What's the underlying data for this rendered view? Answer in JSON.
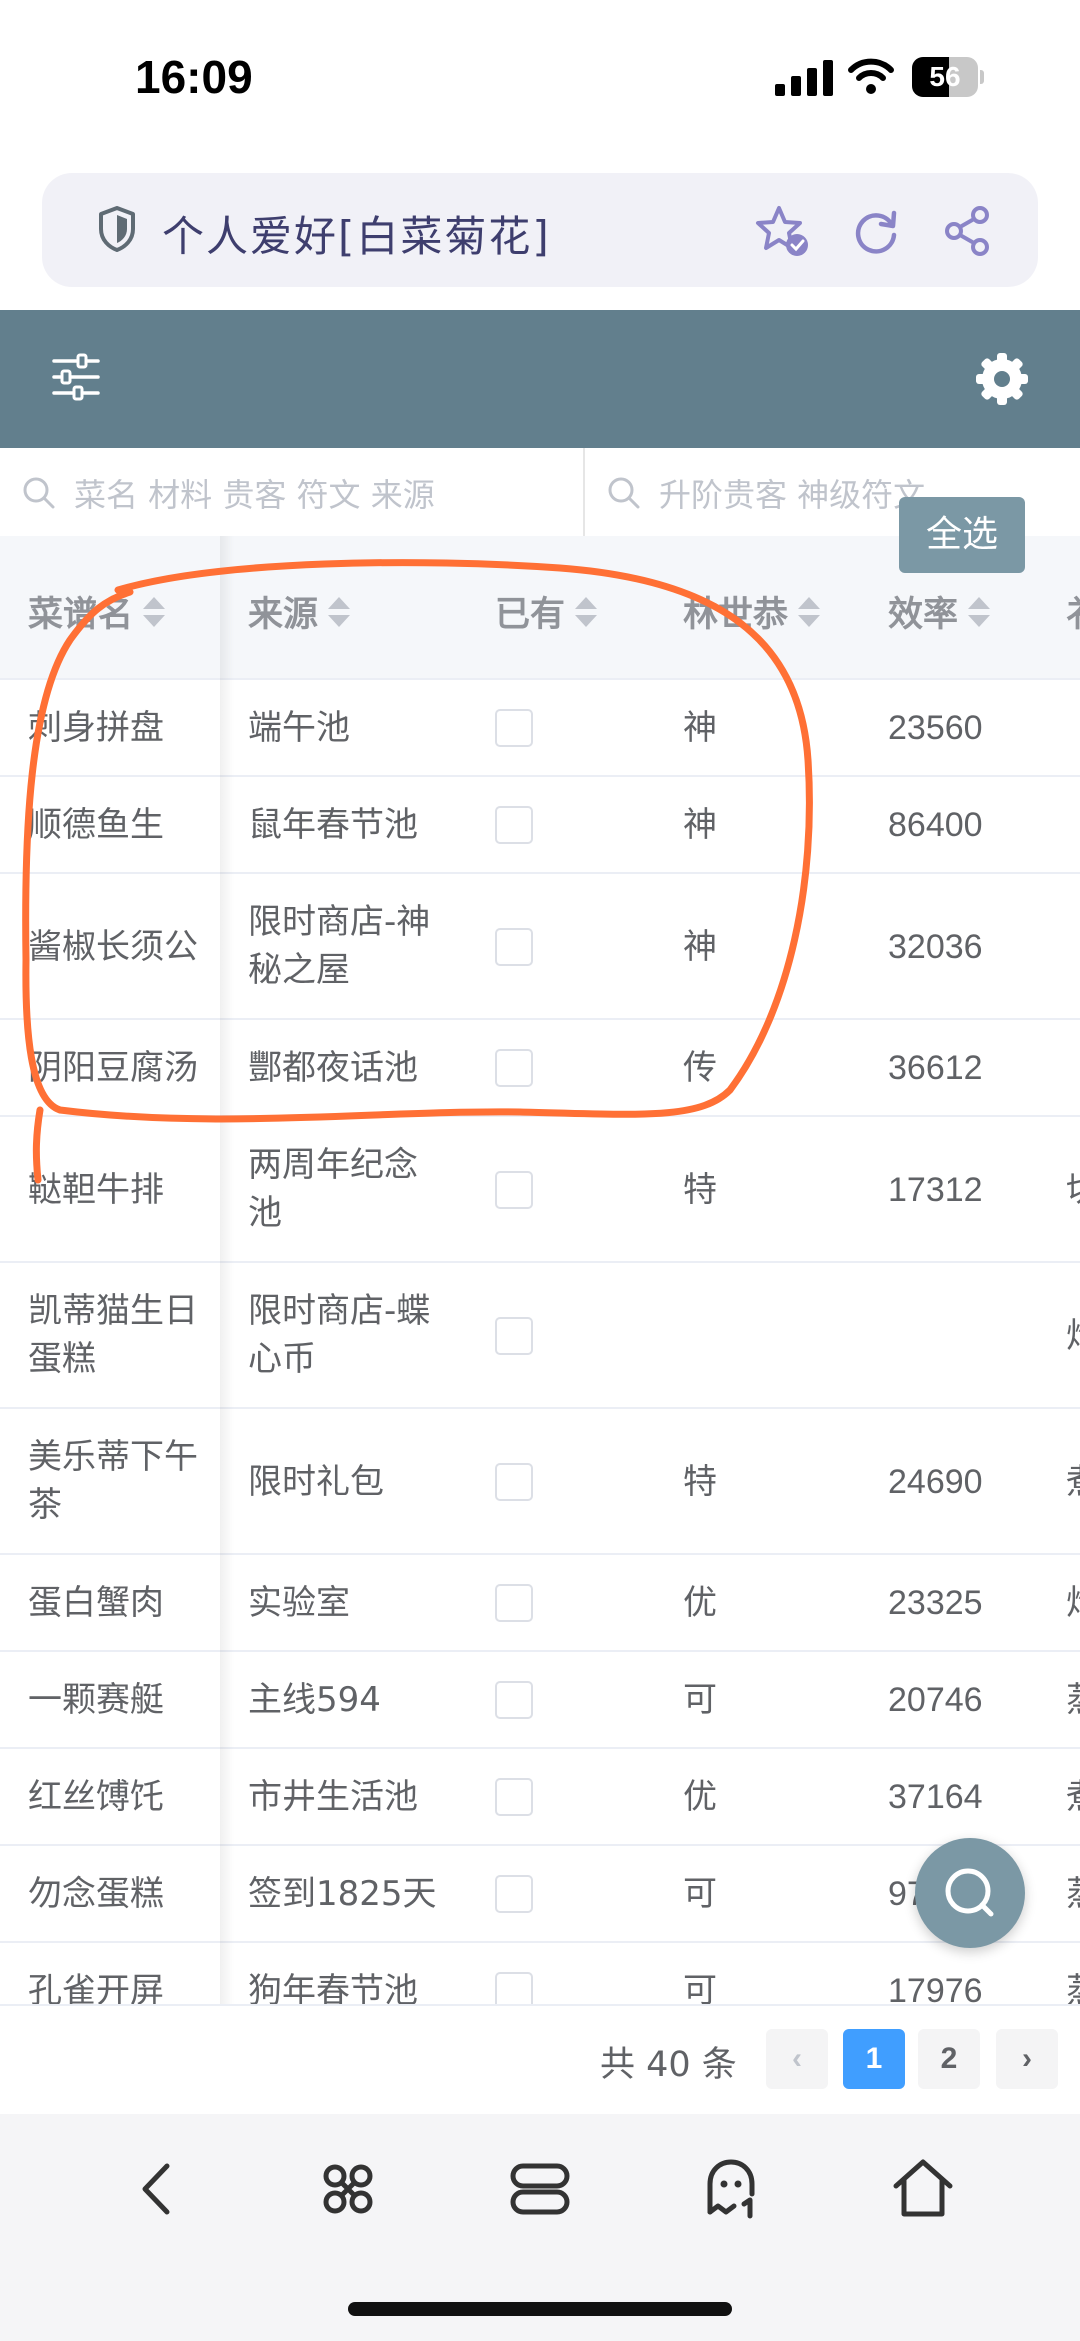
{
  "status_bar": {
    "time": "16:09",
    "battery": "56",
    "battery_level": 0.56,
    "icons": [
      "signal-icon",
      "wifi-icon",
      "battery-icon"
    ]
  },
  "address_bar": {
    "title": "个人爱好[白菜菊花]",
    "icons": [
      "shield-icon",
      "star-check-icon",
      "refresh-icon",
      "share-icon"
    ],
    "accent": "#8a84c7"
  },
  "toolbar": {
    "background": "#627f8d",
    "icons": [
      "filter-icon",
      "gear-icon"
    ]
  },
  "search": {
    "left_placeholder": "菜名 材料 贵客 符文 来源",
    "right_placeholder": "升阶贵客 神级符文",
    "select_all": "全选"
  },
  "table": {
    "columns": [
      "菜谱名",
      "来源",
      "已有",
      "林世恭",
      "效率"
    ],
    "rows": [
      {
        "name": "刺身拼盘",
        "source": "端午池",
        "owned": false,
        "rank": "神",
        "efficiency": "23560",
        "extra": ""
      },
      {
        "name": "顺德鱼生",
        "source": "鼠年春节池",
        "owned": false,
        "rank": "神",
        "efficiency": "86400",
        "extra": ""
      },
      {
        "name": "酱椒长须公",
        "source": "限时商店-神秘之屋",
        "owned": false,
        "rank": "神",
        "efficiency": "32036",
        "extra": ""
      },
      {
        "name": "阴阳豆腐汤",
        "source": "酆都夜话池",
        "owned": false,
        "rank": "传",
        "efficiency": "36612",
        "extra": ""
      },
      {
        "name": "鞑靼牛排",
        "source": "两周年纪念池",
        "owned": false,
        "rank": "特",
        "efficiency": "17312",
        "extra": "切"
      },
      {
        "name": "凯蒂猫生日蛋糕",
        "source": "限时商店-蝶心币",
        "owned": false,
        "rank": "",
        "efficiency": "",
        "extra": "炸"
      },
      {
        "name": "美乐蒂下午茶",
        "source": "限时礼包",
        "owned": false,
        "rank": "特",
        "efficiency": "24690",
        "extra": "煮"
      },
      {
        "name": "蛋白蟹肉",
        "source": "实验室",
        "owned": false,
        "rank": "优",
        "efficiency": "23325",
        "extra": "炸"
      },
      {
        "name": "一颗赛艇",
        "source": "主线594",
        "owned": false,
        "rank": "可",
        "efficiency": "20746",
        "extra": "蒸"
      },
      {
        "name": "红丝馎饦",
        "source": "市井生活池",
        "owned": false,
        "rank": "优",
        "efficiency": "37164",
        "extra": "煮"
      },
      {
        "name": "勿念蛋糕",
        "source": "签到1825天",
        "owned": false,
        "rank": "可",
        "efficiency": "97",
        "extra": "蒸"
      },
      {
        "name": "孔雀开屏",
        "source": "狗年春节池",
        "owned": false,
        "rank": "可",
        "efficiency": "17976",
        "extra": "蒸"
      }
    ]
  },
  "pagination": {
    "total": "共 40 条",
    "pages": [
      "1",
      "2"
    ],
    "current": "1",
    "prev": "‹",
    "next": "›",
    "active_color": "#409eff"
  },
  "fab": {
    "icon": "search-icon",
    "color": "#7b98a5"
  },
  "browser_nav": {
    "icons": [
      "back-icon",
      "apps-icon",
      "tabs-icon",
      "ghost-icon",
      "home-icon"
    ]
  },
  "annotation": {
    "color": "#ff7035"
  }
}
